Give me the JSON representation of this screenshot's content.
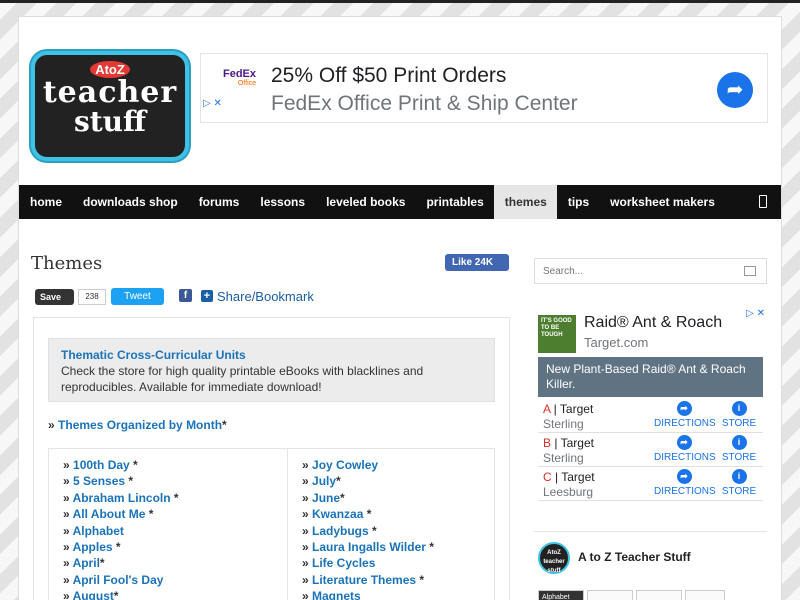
{
  "site": {
    "logo_atoz": "AtoZ",
    "logo_line1": "teacher",
    "logo_line2": "stuff"
  },
  "ad_banner": {
    "brand": "FedEx",
    "brand_sub": "Office",
    "headline": "25% Off $50 Print Orders",
    "subline": "FedEx Office Print & Ship Center",
    "adchoices": "▷ ✕"
  },
  "nav": {
    "items": [
      {
        "label": "home"
      },
      {
        "label": "downloads shop"
      },
      {
        "label": "forums"
      },
      {
        "label": "lessons"
      },
      {
        "label": "leveled books"
      },
      {
        "label": "printables"
      },
      {
        "label": "themes",
        "active": true
      },
      {
        "label": "tips"
      },
      {
        "label": "worksheet makers"
      }
    ]
  },
  "page": {
    "title": "Themes",
    "fb_like": "Like 24K",
    "pin_save": "Save",
    "pin_count": "238",
    "tweet": "Tweet",
    "share_bookmark": "Share/Bookmark"
  },
  "callout": {
    "title": "Thematic Cross-Curricular Units",
    "text": "Check the store for high quality printable eBooks with blacklines and reproducibles. Available for immediate download!"
  },
  "by_month": {
    "prefix": "»",
    "link": "Themes Organized by Month",
    "suffix": "*"
  },
  "themes_col1": [
    {
      "label": "100th Day",
      "star": " *"
    },
    {
      "label": "5 Senses",
      "star": " *"
    },
    {
      "label": "Abraham Lincoln",
      "star": " *"
    },
    {
      "label": "All About Me",
      "star": " *"
    },
    {
      "label": "Alphabet",
      "star": ""
    },
    {
      "label": "Apples",
      "star": " *"
    },
    {
      "label": "April",
      "star": "*"
    },
    {
      "label": "April Fool's Day",
      "star": ""
    },
    {
      "label": "August",
      "star": "*"
    }
  ],
  "themes_col2": [
    {
      "label": "Joy Cowley",
      "star": ""
    },
    {
      "label": "July",
      "star": "*"
    },
    {
      "label": "June",
      "star": "*"
    },
    {
      "label": "Kwanzaa",
      "star": " *"
    },
    {
      "label": "Ladybugs",
      "star": " *"
    },
    {
      "label": "Laura Ingalls Wilder",
      "star": " *"
    },
    {
      "label": "Life Cycles",
      "star": ""
    },
    {
      "label": "Literature Themes",
      "star": " *"
    },
    {
      "label": "Magnets",
      "star": ""
    }
  ],
  "sidebar": {
    "search_placeholder": "Search...",
    "ad": {
      "thumb_text": "IT'S GOOD TO BE TOUGH",
      "title": "Raid® Ant & Roach",
      "source": "Target.com",
      "promo": "New Plant-Based Raid® Ant & Roach Killer.",
      "directions_label": "DIRECTIONS",
      "store_label": "STORE",
      "locations": [
        {
          "letter": "A",
          "name": "Target",
          "city": "Sterling"
        },
        {
          "letter": "B",
          "name": "Target",
          "city": "Sterling"
        },
        {
          "letter": "C",
          "name": "Target",
          "city": "Leesburg"
        }
      ]
    },
    "fb_page": {
      "avatar_text": "AtoZ teacher stuff",
      "name": "A to Z Teacher Stuff",
      "strip_text": "Alphabet Chart Printables"
    }
  },
  "colors": {
    "link": "#1a73b8",
    "nav_bg": "#111111",
    "nav_active_bg": "#e6e6e6",
    "ad_blue": "#1a73e8"
  }
}
